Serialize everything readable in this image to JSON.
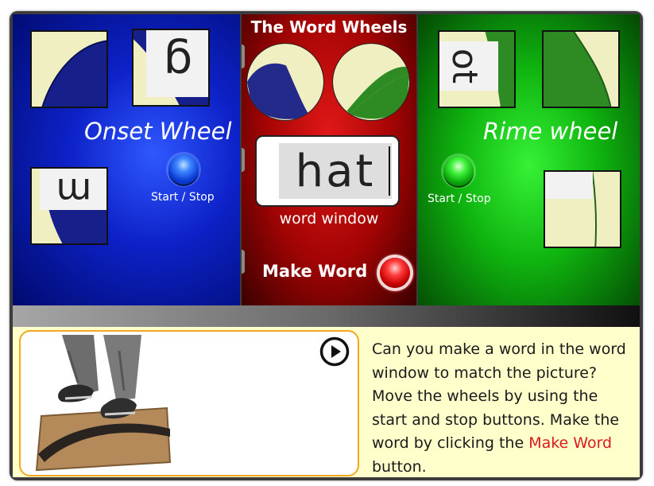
{
  "title": "The Word Wheels",
  "onset": {
    "label": "Onset Wheel",
    "start_stop": "Start / Stop",
    "tile_top_right_letter": "g",
    "tile_bottom_left_letter": "m",
    "color": "#1533d8"
  },
  "rime": {
    "label": "Rime wheel",
    "start_stop": "Start / Stop",
    "tile_top_left_letters": "ot",
    "color": "#18c818"
  },
  "word_window": {
    "word": "hat",
    "label": "word window"
  },
  "make_word": {
    "label": "Make Word"
  },
  "instructions": {
    "part1": "Can you make a word in the word window to match the picture? Move the wheels by using the start and stop buttons. Make the word by clicking the ",
    "highlight": "Make Word",
    "part2": " button.",
    "highlight_color": "#d81b1b"
  },
  "icons": {
    "play": "play-icon",
    "onset_button": "blue-round-button-icon",
    "rime_button": "green-round-button-icon",
    "make_word_button": "red-round-button-icon"
  }
}
